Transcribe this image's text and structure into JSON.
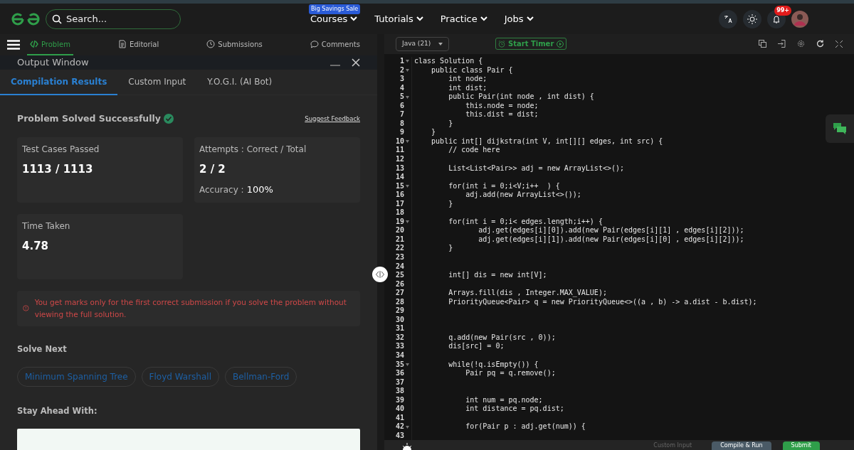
{
  "header": {
    "search": {
      "placeholder": "Search..."
    },
    "sale_badge": "Big Savings Sale",
    "menu": [
      {
        "label": "Courses"
      },
      {
        "label": "Tutorials"
      },
      {
        "label": "Practice"
      },
      {
        "label": "Jobs"
      }
    ],
    "notification_count": "99+"
  },
  "problem_tabs": [
    {
      "label": "Problem",
      "selected": true
    },
    {
      "label": "Editorial",
      "selected": false
    },
    {
      "label": "Submissions",
      "selected": false
    },
    {
      "label": "Comments",
      "selected": false
    }
  ],
  "output_window": {
    "title": "Output Window",
    "tabs": [
      {
        "label": "Compilation Results",
        "selected": true
      },
      {
        "label": "Custom Input",
        "selected": false
      },
      {
        "label": "Y.O.G.I. (AI Bot)",
        "selected": false
      }
    ],
    "status": "Problem Solved Successfully",
    "feedback_link": "Suggest Feedback",
    "stats": [
      {
        "label": "Test Cases Passed",
        "value": "1113 / 1113"
      },
      {
        "label": "Attempts : Correct / Total",
        "value": "2 / 2",
        "extra_label": "Accuracy :",
        "extra_value": "100%"
      },
      {
        "label": "Time Taken",
        "value": "4.78"
      }
    ],
    "warning": "You get marks only for the first correct submission if you solve the problem without viewing the full solution.",
    "solve_next_title": "Solve Next",
    "solve_next": [
      "Minimum Spanning Tree",
      "Floyd Warshall",
      "Bellman-Ford"
    ],
    "stay_ahead_title": "Stay Ahead With:"
  },
  "editor": {
    "language": "Java (21)",
    "timer_button": "Start Timer",
    "lines": [
      {
        "n": "1",
        "fold": true,
        "code": "class Solution {"
      },
      {
        "n": "2",
        "fold": true,
        "code": "    public class Pair {"
      },
      {
        "n": "3",
        "fold": false,
        "code": "        int node;"
      },
      {
        "n": "4",
        "fold": false,
        "code": "        int dist;"
      },
      {
        "n": "5",
        "fold": true,
        "code": "        public Pair(int node , int dist) {"
      },
      {
        "n": "6",
        "fold": false,
        "code": "            this.node = node;"
      },
      {
        "n": "7",
        "fold": false,
        "code": "            this.dist = dist;"
      },
      {
        "n": "8",
        "fold": false,
        "code": "        }"
      },
      {
        "n": "9",
        "fold": false,
        "code": "    }"
      },
      {
        "n": "10",
        "fold": true,
        "code": "    public int[] dijkstra(int V, int[][] edges, int src) {"
      },
      {
        "n": "11",
        "fold": false,
        "code": "        // code here"
      },
      {
        "n": "12",
        "fold": false
      },
      {
        "n": "13",
        "fold": false,
        "code": "        List<List<Pair>> adj = new ArrayList<>();"
      },
      {
        "n": "14",
        "fold": false
      },
      {
        "n": "15",
        "fold": true,
        "code": "        for(int i = 0;i<V;i++  ) {"
      },
      {
        "n": "16",
        "fold": false,
        "code": "            adj.add(new ArrayList<>());"
      },
      {
        "n": "17",
        "fold": false,
        "code": "        }"
      },
      {
        "n": "18",
        "fold": false
      },
      {
        "n": "19",
        "fold": true,
        "code": "        for(int i = 0;i< edges.length;i++) {"
      },
      {
        "n": "20",
        "fold": false,
        "code": "               adj.get(edges[i][0]).add(new Pair(edges[i][1] , edges[i][2]));"
      },
      {
        "n": "21",
        "fold": false,
        "code": "               adj.get(edges[i][1]).add(new Pair(edges[i][0] , edges[i][2]));"
      },
      {
        "n": "22",
        "fold": false,
        "code": "        }"
      },
      {
        "n": "23",
        "fold": false
      },
      {
        "n": "24",
        "fold": false
      },
      {
        "n": "25",
        "fold": false,
        "code": "        int[] dis = new int[V];"
      },
      {
        "n": "26",
        "fold": false
      },
      {
        "n": "27",
        "fold": false,
        "code": "        Arrays.fill(dis , Integer.MAX_VALUE);"
      },
      {
        "n": "28",
        "fold": false,
        "code": "        PriorityQueue<Pair> q = new PriorityQueue<>((a , b) -> a.dist - b.dist);"
      },
      {
        "n": "29",
        "fold": false
      },
      {
        "n": "30",
        "fold": false
      },
      {
        "n": "31",
        "fold": false
      },
      {
        "n": "32",
        "fold": false,
        "code": "        q.add(new Pair(src , 0));"
      },
      {
        "n": "33",
        "fold": false,
        "code": "        dis[src] = 0;"
      },
      {
        "n": "34",
        "fold": false
      },
      {
        "n": "35",
        "fold": true,
        "code": "        while(!q.isEmpty()) {"
      },
      {
        "n": "36",
        "fold": false,
        "code": "            Pair pq = q.remove();"
      },
      {
        "n": "37",
        "fold": false
      },
      {
        "n": "38",
        "fold": false
      },
      {
        "n": "39",
        "fold": false,
        "code": "            int num = pq.node;"
      },
      {
        "n": "40",
        "fold": false,
        "code": "            int distance = pq.dist;"
      },
      {
        "n": "41",
        "fold": false
      },
      {
        "n": "42",
        "fold": true,
        "code": "            for(Pair p : adj.get(num)) {"
      },
      {
        "n": "43",
        "fold": false
      }
    ],
    "footer": [
      {
        "label": "Custom Input",
        "kind": "link"
      },
      {
        "label": "Compile & Run",
        "kind": "secondary"
      },
      {
        "label": "Submit",
        "kind": "primary"
      }
    ]
  }
}
